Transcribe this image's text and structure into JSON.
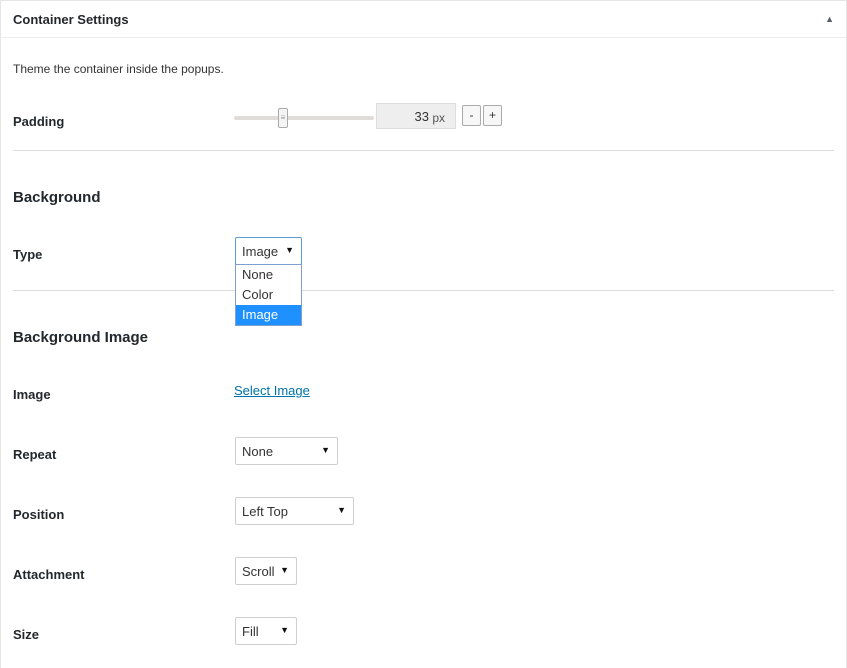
{
  "panel": {
    "title": "Container Settings",
    "description": "Theme the container inside the popups."
  },
  "padding": {
    "label": "Padding",
    "value": "33",
    "unit": "px",
    "minus_label": "-",
    "plus_label": "+"
  },
  "background": {
    "heading": "Background",
    "type_label": "Type",
    "type_value": "Image",
    "type_options": [
      "None",
      "Color",
      "Image"
    ]
  },
  "background_image": {
    "heading": "Background Image",
    "image_label": "Image",
    "select_image_link": "Select Image",
    "repeat_label": "Repeat",
    "repeat_value": "None",
    "position_label": "Position",
    "position_value": "Left Top",
    "attachment_label": "Attachment",
    "attachment_value": "Scroll",
    "size_label": "Size",
    "size_value": "Fill"
  },
  "icons": {
    "collapse": "triangle-up-icon",
    "dropdown": "triangle-down-icon",
    "slider_grip": "grip-icon"
  }
}
